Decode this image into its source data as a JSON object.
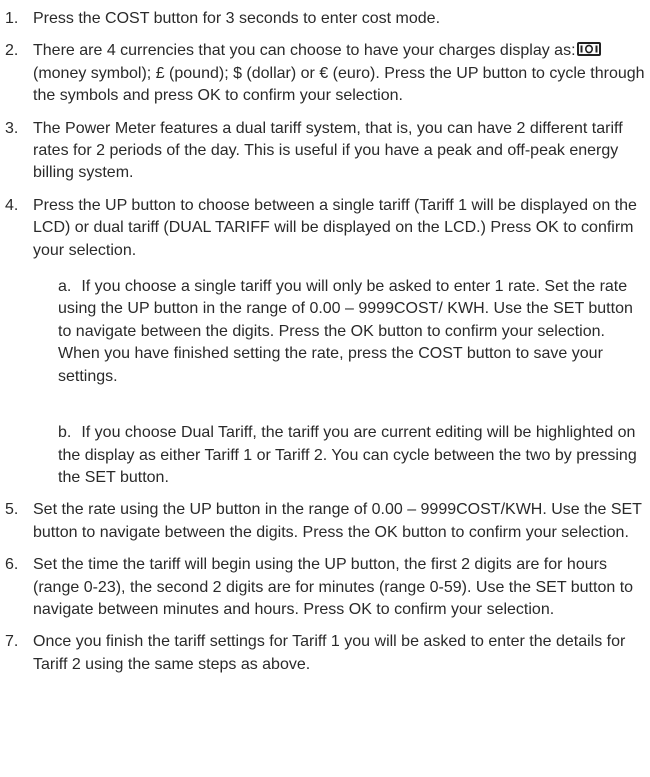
{
  "items": [
    {
      "num": "1.",
      "text": "Press the COST button for 3 seconds to enter cost mode."
    },
    {
      "num": "2.",
      "text_before": "There are 4 currencies that you can choose to have your charges display as:",
      "text_after": "(money symbol); £ (pound); $ (dollar) or € (euro). Press the UP button to cycle through the symbols and press OK to confirm your selection.",
      "icon": "money-symbol-icon"
    },
    {
      "num": "3.",
      "text": "The Power Meter features a dual tariff system, that is, you can have 2 different tariff rates for 2 periods of the day. This is useful if you have a peak and off-peak energy billing system."
    },
    {
      "num": "4.",
      "text": "Press the UP button to choose between a single tariff (Tariff 1 will be displayed on the LCD) or dual tariff (DUAL TARIFF will be displayed on the LCD.) Press OK to confirm your selection."
    },
    {
      "num": "5.",
      "text": "Set the rate using the UP button in the range of 0.00 – 9999COST/KWH. Use the SET button to navigate between the digits. Press the OK button to confirm your selection."
    },
    {
      "num": "6.",
      "text": "Set the time the tariff will begin using the UP button, the first 2 digits are for hours (range 0-23), the second 2 digits are for minutes (range 0-59). Use the SET button to navigate between minutes and hours. Press OK to confirm your selection."
    },
    {
      "num": "7.",
      "text": "Once you finish the tariff settings for Tariff 1 you will be asked to enter the details for Tariff 2 using the same steps as above."
    }
  ],
  "subitems": [
    {
      "label": "a.",
      "text": "If you choose a single tariff you will only be asked to enter 1 rate. Set the rate using the UP button in the range of 0.00 – 9999COST/ KWH. Use the SET button to navigate between the digits. Press the OK button to confirm your selection. When you have finished setting the rate, press the COST button to save your settings."
    },
    {
      "label": "b.",
      "text": "If you choose Dual Tariff, the tariff you are current editing will be highlighted on the display as either Tariff 1 or Tariff 2. You can cycle between the two by pressing the SET button."
    }
  ]
}
